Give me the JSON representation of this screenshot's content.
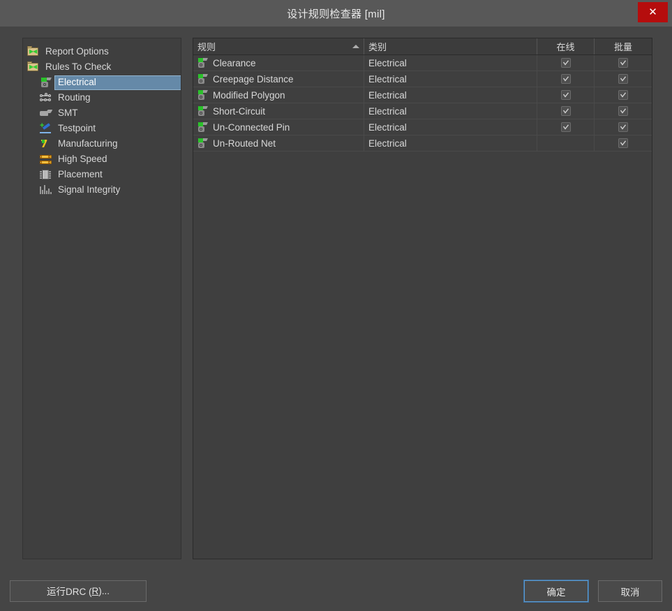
{
  "window": {
    "title": "设计规则检查器 [mil]",
    "close_label": "✕"
  },
  "sidebar": {
    "items": [
      {
        "label": "Report Options",
        "icon": "folder-icon",
        "level": 0,
        "selected": false
      },
      {
        "label": "Rules To Check",
        "icon": "folder-icon",
        "level": 0,
        "selected": false
      },
      {
        "label": "Electrical",
        "icon": "electrical-icon",
        "level": 1,
        "selected": true
      },
      {
        "label": "Routing",
        "icon": "routing-icon",
        "level": 1,
        "selected": false
      },
      {
        "label": "SMT",
        "icon": "smt-icon",
        "level": 1,
        "selected": false
      },
      {
        "label": "Testpoint",
        "icon": "testpoint-icon",
        "level": 1,
        "selected": false
      },
      {
        "label": "Manufacturing",
        "icon": "manufacturing-icon",
        "level": 1,
        "selected": false
      },
      {
        "label": "High Speed",
        "icon": "high-speed-icon",
        "level": 1,
        "selected": false
      },
      {
        "label": "Placement",
        "icon": "placement-icon",
        "level": 1,
        "selected": false
      },
      {
        "label": "Signal Integrity",
        "icon": "signal-integrity-icon",
        "level": 1,
        "selected": false
      }
    ]
  },
  "table": {
    "columns": [
      {
        "key": "rule",
        "label": "规则",
        "sorted": "asc"
      },
      {
        "key": "category",
        "label": "类别",
        "sorted": ""
      },
      {
        "key": "online",
        "label": "在线",
        "sorted": ""
      },
      {
        "key": "batch",
        "label": "批量",
        "sorted": ""
      }
    ],
    "rows": [
      {
        "rule": "Clearance",
        "category": "Electrical",
        "online": true,
        "batch": true
      },
      {
        "rule": "Creepage Distance",
        "category": "Electrical",
        "online": true,
        "batch": true
      },
      {
        "rule": "Modified Polygon",
        "category": "Electrical",
        "online": true,
        "batch": true
      },
      {
        "rule": "Short-Circuit",
        "category": "Electrical",
        "online": true,
        "batch": true
      },
      {
        "rule": "Un-Connected Pin",
        "category": "Electrical",
        "online": true,
        "batch": true
      },
      {
        "rule": "Un-Routed Net",
        "category": "Electrical",
        "online": false,
        "batch": true
      }
    ]
  },
  "footer": {
    "run_drc_prefix": "运行DRC (",
    "run_drc_accel": "R",
    "run_drc_suffix": ")...",
    "ok_label": "确定",
    "cancel_label": "取消"
  },
  "colors": {
    "window_bg": "#454545",
    "titlebar_bg": "#585858",
    "panel_bg": "#3f3f3f",
    "close_red": "#b50d0d",
    "selection_blue": "#6589a8",
    "focus_blue": "#5d9bd1",
    "text": "#d8d8d8"
  }
}
